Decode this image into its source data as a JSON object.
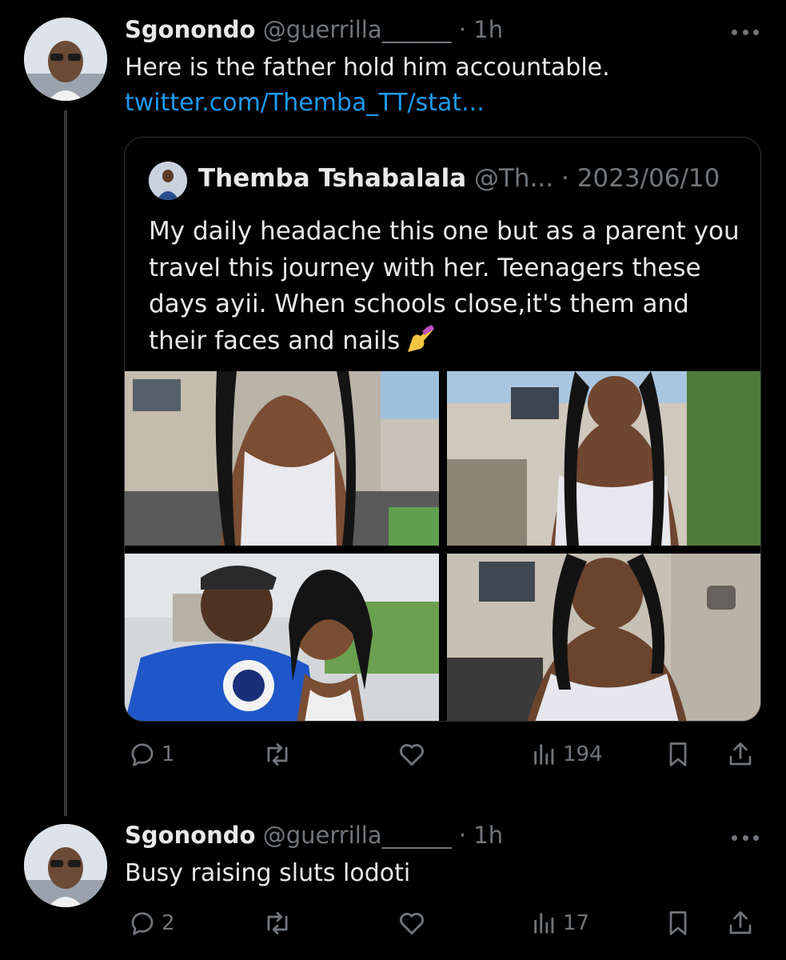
{
  "tweets": [
    {
      "name": "Sgonondo",
      "handle": "@guerrilla______",
      "time": "· 1h",
      "text": "Here is the father hold him accountable.",
      "link": "twitter.com/Themba_TT/stat...",
      "quote": {
        "name": "Themba Tshabalala",
        "handle": "@Th...",
        "date": "· 2023/06/10",
        "text": "My daily headache this one but as a parent you travel this journey with her. Teenagers these days ayii. When schools close,it's them and their faces and nails",
        "emoji": "nail-polish-emoji",
        "photos": [
          "photo-1-white-halter-top",
          "photo-2-smiling-in-driveway",
          "photo-3-selfie-with-father",
          "photo-4-smiling-closeup"
        ]
      },
      "stats": {
        "replies": "1",
        "retweets": "",
        "likes": "",
        "views": "194"
      }
    },
    {
      "name": "Sgonondo",
      "handle": "@guerrilla______",
      "time": "· 1h",
      "text": "Busy raising sluts lodoti",
      "stats": {
        "replies": "2",
        "retweets": "",
        "likes": "",
        "views": "17"
      }
    }
  ],
  "colors": {
    "background": "#000000",
    "text": "#e7e9ea",
    "muted": "#71767b",
    "link": "#1d9bf0",
    "border": "#2f3336"
  }
}
